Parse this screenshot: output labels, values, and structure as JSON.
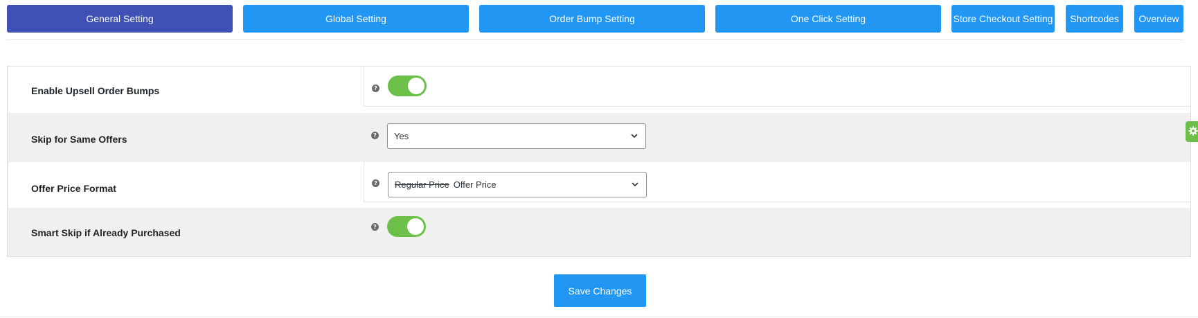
{
  "tabs": [
    {
      "label": "General Setting",
      "active": true
    },
    {
      "label": "Global Setting",
      "active": false
    },
    {
      "label": "Order Bump Setting",
      "active": false
    },
    {
      "label": "One Click Setting",
      "active": false
    },
    {
      "label": "Store Checkout Setting",
      "active": false
    },
    {
      "label": "Shortcodes",
      "active": false
    },
    {
      "label": "Overview",
      "active": false
    }
  ],
  "settings": {
    "enable_upsell": {
      "label": "Enable Upsell Order Bumps",
      "enabled": true,
      "help": "?"
    },
    "skip_same_offers": {
      "label": "Skip for Same Offers",
      "value": "Yes",
      "help": "?"
    },
    "offer_price_format": {
      "label": "Offer Price Format",
      "regular": "Regular Price",
      "offer": "Offer Price",
      "help": "?"
    },
    "smart_skip": {
      "label": "Smart Skip if Already Purchased",
      "enabled": true,
      "help": "?"
    }
  },
  "save_label": "Save Changes",
  "colors": {
    "tab": "#2196f3",
    "tab_active": "#3f51b5",
    "toggle_on": "#6cc04a",
    "button": "#2196f3"
  }
}
